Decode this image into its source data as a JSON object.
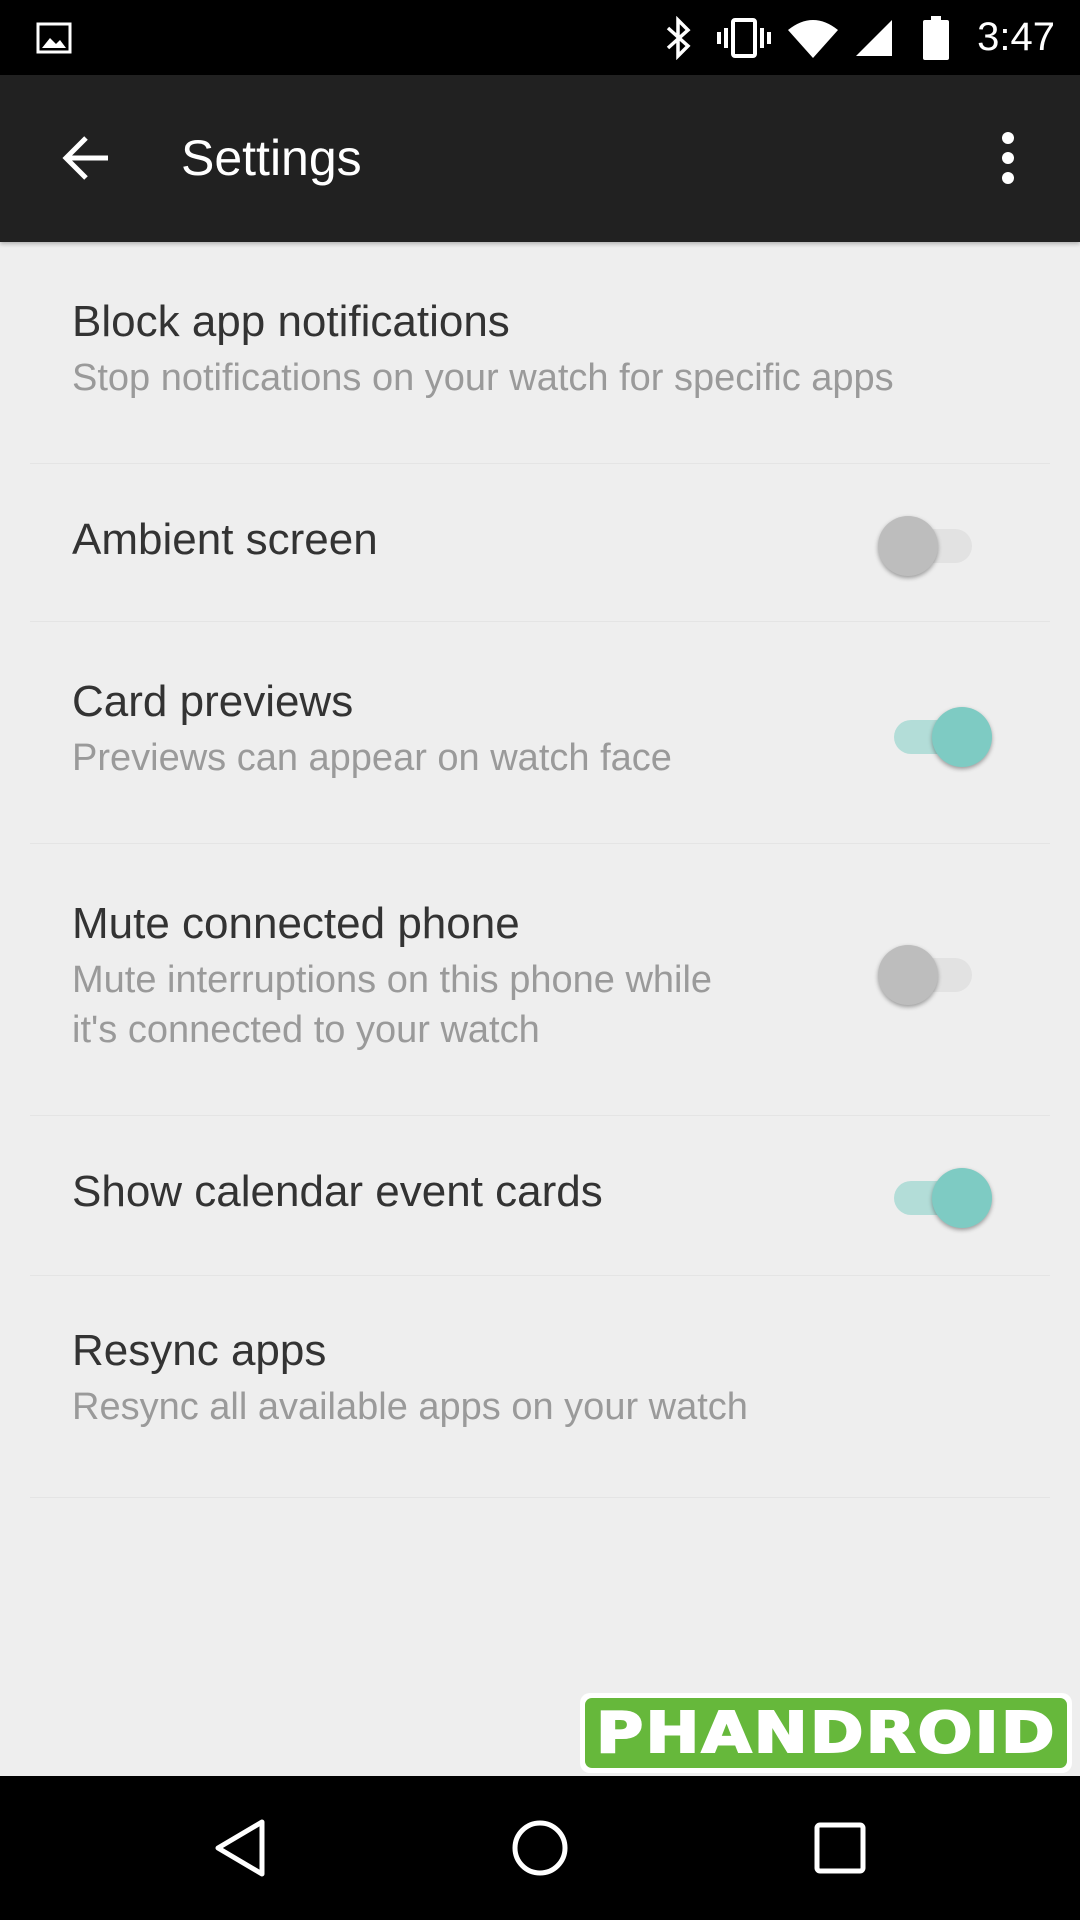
{
  "status_bar": {
    "time": "3:47",
    "icons": [
      "image-notification-icon",
      "bluetooth-icon",
      "vibrate-icon",
      "wifi-icon",
      "cell-signal-icon",
      "battery-icon"
    ]
  },
  "toolbar": {
    "title": "Settings",
    "back_icon": "arrow-back-icon",
    "overflow_icon": "more-vert-icon"
  },
  "settings": [
    {
      "title": "Block app notifications",
      "summary": "Stop notifications on your watch for specific apps",
      "switch": null
    },
    {
      "title": "Ambient screen",
      "summary": "",
      "switch": false
    },
    {
      "title": "Card previews",
      "summary": "Previews can appear on watch face",
      "switch": true
    },
    {
      "title": "Mute connected phone",
      "summary_lines": [
        "Mute interruptions on this phone while",
        "it's connected to your watch"
      ],
      "switch": false
    },
    {
      "title": "Show calendar event cards",
      "summary": "",
      "switch": true
    },
    {
      "title": "Resync apps",
      "summary": "Resync all available apps on your watch",
      "switch": null
    }
  ],
  "watermark": {
    "text": "PHANDROID"
  },
  "nav_bar": {
    "icons": [
      "back-triangle-icon",
      "home-circle-icon",
      "recents-square-icon"
    ]
  },
  "colors": {
    "toolbar": "#212121",
    "accent": "#7ecbc3",
    "background": "#eeeeee"
  }
}
